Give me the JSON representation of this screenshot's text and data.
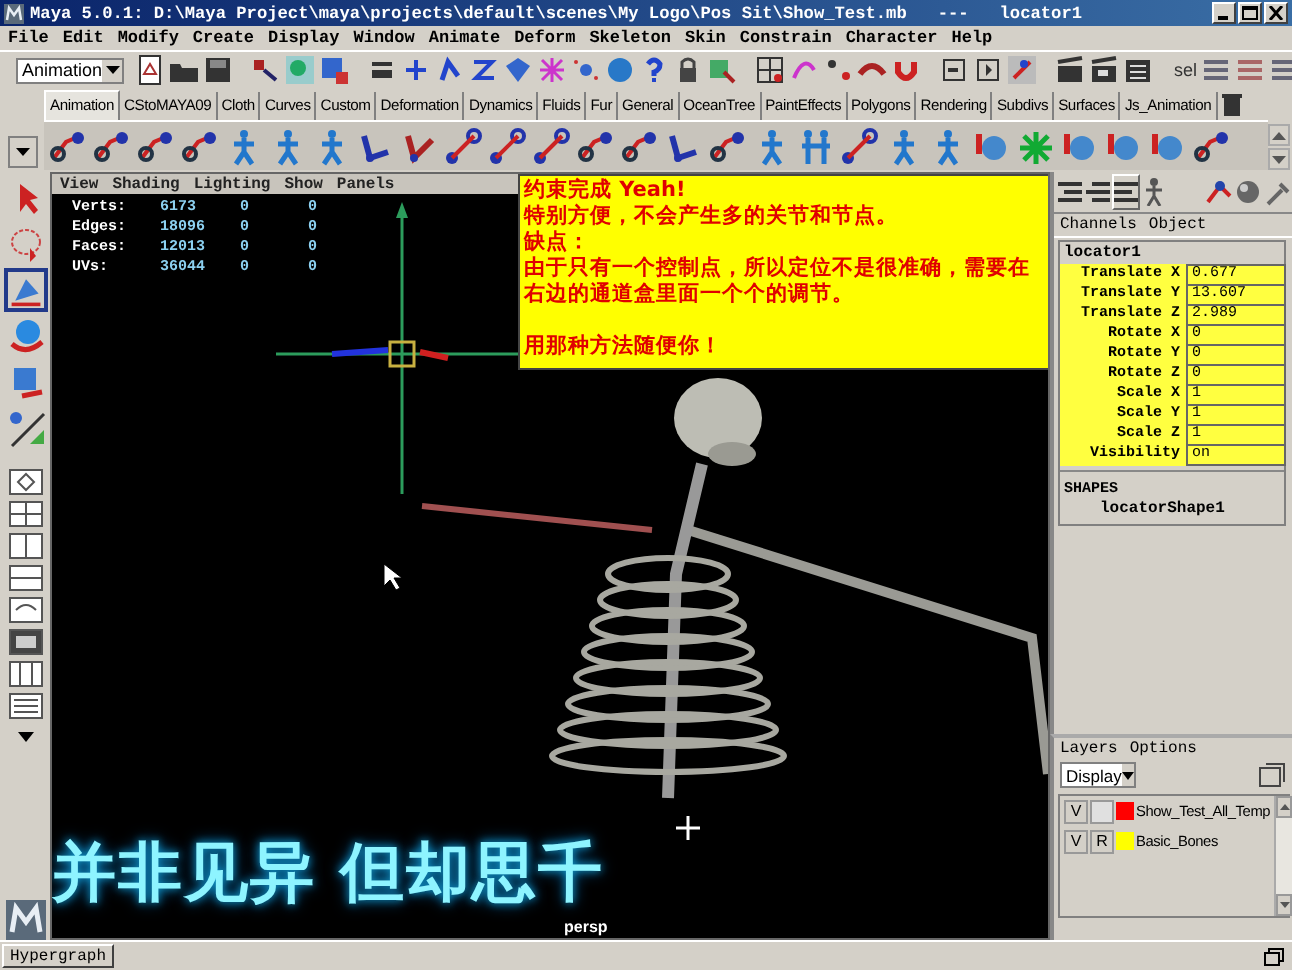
{
  "window": {
    "title": "Maya 5.0.1: D:\\Maya Project\\maya\\projects\\default\\scenes\\My Logo\\Pos Sit\\Show_Test.mb   ---   locator1"
  },
  "menu_bar": [
    "File",
    "Edit",
    "Modify",
    "Create",
    "Display",
    "Window",
    "Animate",
    "Deform",
    "Skeleton",
    "Skin",
    "Constrain",
    "Character",
    "Help"
  ],
  "status_line": {
    "mode": "Animation",
    "sel_label": "sel"
  },
  "shelf_tabs": [
    {
      "label": "Animation",
      "selected": true
    },
    {
      "label": "CStoMAYA09",
      "selected": false
    },
    {
      "label": "Cloth",
      "selected": false
    },
    {
      "label": "Curves",
      "selected": false
    },
    {
      "label": "Custom",
      "selected": false
    },
    {
      "label": "Deformation",
      "selected": false
    },
    {
      "label": "Dynamics",
      "selected": false
    },
    {
      "label": "Fluids",
      "selected": false
    },
    {
      "label": "Fur",
      "selected": false
    },
    {
      "label": "General",
      "selected": false
    },
    {
      "label": "OceanTree",
      "selected": false
    },
    {
      "label": "PaintEffects",
      "selected": false
    },
    {
      "label": "Polygons",
      "selected": false
    },
    {
      "label": "Rendering",
      "selected": false
    },
    {
      "label": "Subdivs",
      "selected": false
    },
    {
      "label": "Surfaces",
      "selected": false
    },
    {
      "label": "Js_Animation",
      "selected": false
    }
  ],
  "viewport": {
    "menu": [
      "View",
      "Shading",
      "Lighting",
      "Show",
      "Panels"
    ],
    "stats": [
      {
        "label": "Verts:",
        "values": [
          "6173",
          "0",
          "0"
        ]
      },
      {
        "label": "Edges:",
        "values": [
          "18096",
          "0",
          "0"
        ]
      },
      {
        "label": "Faces:",
        "values": [
          "12013",
          "0",
          "0"
        ]
      },
      {
        "label": "UVs:",
        "values": [
          "36044",
          "0",
          "0"
        ]
      }
    ],
    "note": [
      "约束完成 Yeah!",
      "特别方便，不会产生多的关节和节点。",
      "缺点：",
      "由于只有一个控制点，所以定位不是很准确，需要在右边的通道盒里面一个个的调节。",
      "用那种方法随便你！"
    ],
    "caption": "并非见异 但却思千",
    "camera": "persp"
  },
  "channel_box": {
    "menu": [
      "Channels",
      "Object"
    ],
    "object": "locator1",
    "channels": [
      {
        "name": "Translate X",
        "value": "0.677",
        "highlighted": true
      },
      {
        "name": "Translate Y",
        "value": "13.607",
        "highlighted": true
      },
      {
        "name": "Translate Z",
        "value": "2.989",
        "highlighted": true
      },
      {
        "name": "Rotate X",
        "value": "0",
        "highlighted": true
      },
      {
        "name": "Rotate Y",
        "value": "0",
        "highlighted": true
      },
      {
        "name": "Rotate Z",
        "value": "0",
        "highlighted": true
      },
      {
        "name": "Scale X",
        "value": "1",
        "highlighted": true
      },
      {
        "name": "Scale Y",
        "value": "1",
        "highlighted": true
      },
      {
        "name": "Scale Z",
        "value": "1",
        "highlighted": true
      },
      {
        "name": "Visibility",
        "value": "on",
        "highlighted": true
      }
    ],
    "shapes_heading": "SHAPES",
    "shape": "locatorShape1"
  },
  "layer_editor": {
    "menu": [
      "Layers",
      "Options"
    ],
    "display": "Display",
    "layers": [
      {
        "visible": "V",
        "color": "#ff0000",
        "name": "Show_Test_All_Temp"
      },
      {
        "visible": "V",
        "mode": "R",
        "color": "#ffff00",
        "name": "Basic_Bones"
      }
    ]
  },
  "taskbar": [
    "Hypergraph"
  ]
}
